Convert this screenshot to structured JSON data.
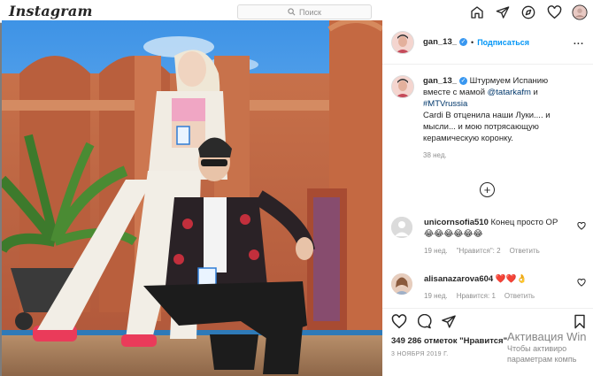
{
  "topnav": {
    "logo": "Instagram",
    "search_placeholder": "Поиск",
    "icons": [
      "home-icon",
      "direct-icon",
      "explore-icon",
      "heart-icon",
      "profile-avatar"
    ]
  },
  "post": {
    "username": "gan_13_",
    "follow_label": "Подписаться",
    "more_label": "...",
    "caption": {
      "username": "gan_13_",
      "line1": "Штурмуем Испанию вместе с мамой ",
      "mention1": "@tatarkafm",
      "and": " и ",
      "mention2": "#MTVrussia",
      "rest": "Cardi B отценила наши Луки.... и мысли... и мою потрясающую керамическую коронку.",
      "age": "38 нед."
    },
    "comments": [
      {
        "username": "unicornsofia510",
        "text": "Конец просто ОР😂😂😂😂😂😂",
        "age": "19 нед.",
        "likes": "\"Нравится\": 2",
        "reply": "Ответить"
      },
      {
        "username": "alisanazarova604",
        "text": "❤️❤️👌",
        "age": "19 нед.",
        "likes": "Нравится: 1",
        "reply": "Ответить"
      }
    ],
    "likes_text": "349 286 отметок \"Нравится\"",
    "date": "3 НОЯБРЯ 2019 Г."
  },
  "watermark": {
    "line1": "Активация Win",
    "line2": "Чтобы активиро",
    "line3": "параметрам компь"
  },
  "colors": {
    "accent": "#0095f6",
    "verified": "#3897f0",
    "overlay": "#7d7d7d"
  }
}
